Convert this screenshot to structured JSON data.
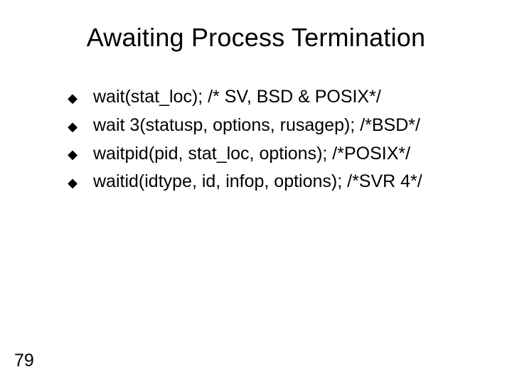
{
  "title": "Awaiting Process Termination",
  "bullets": {
    "icon": "◆",
    "items": [
      "wait(stat_loc); /* SV, BSD & POSIX*/",
      "wait 3(statusp, options, rusagep); /*BSD*/",
      "waitpid(pid, stat_loc, options); /*POSIX*/",
      "waitid(idtype, id, infop, options); /*SVR 4*/"
    ]
  },
  "page_number": "79"
}
